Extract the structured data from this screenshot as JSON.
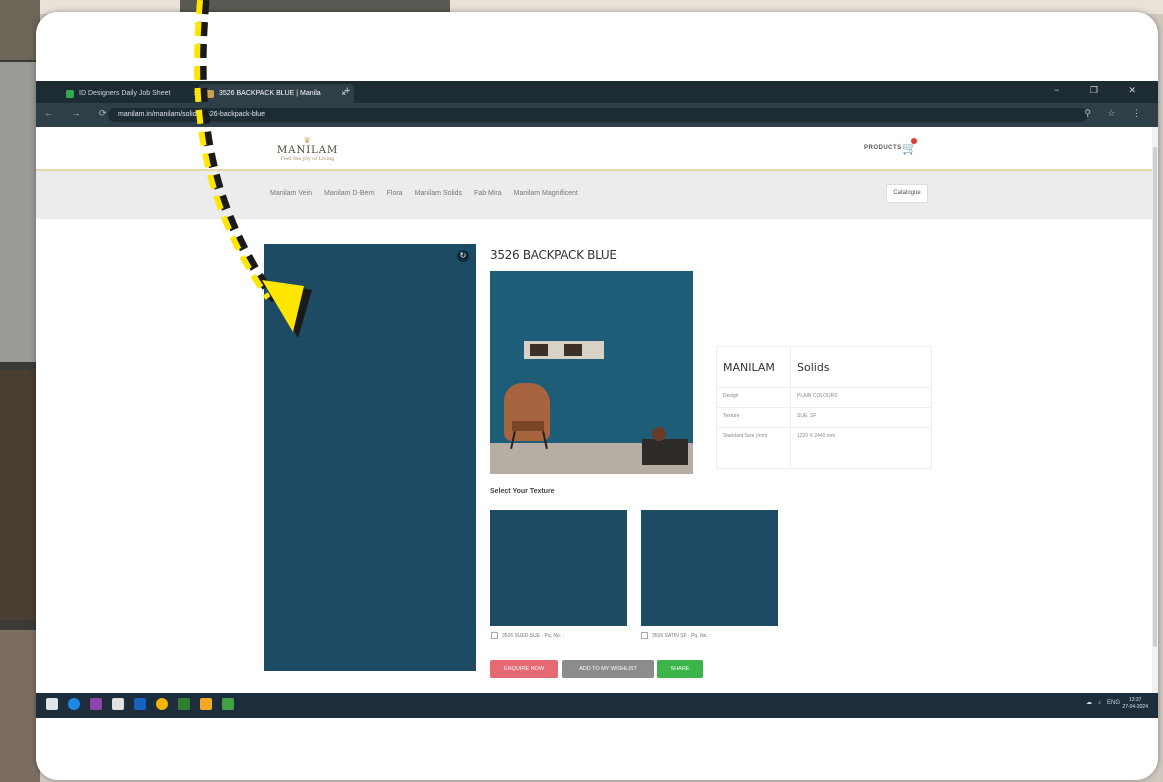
{
  "browser": {
    "tabs": [
      {
        "label": "ID Designers Daily Job Sheet",
        "icon_color": "#34a853"
      },
      {
        "label": "3526 BACKPACK BLUE | Manila",
        "icon_color": "#c9a24b"
      }
    ],
    "url": "manilam.in/manilam/solids/3526-backpack-blue",
    "new_tab_symbol": "+",
    "window_controls": "− ❐ ✕"
  },
  "site": {
    "logo_text": "MANILAM",
    "logo_tagline": "Feel the Joy of Living",
    "products_label": "PRODUCTS",
    "nav_links": [
      "Manilam Vein",
      "Manilam D-Bern",
      "Flora",
      "Manilam Solids",
      "Fab Mira",
      "Manilam Magnificent"
    ],
    "catalogue_label": "Catalogue"
  },
  "product": {
    "title": "3526 BACKPACK BLUE",
    "color": "#1d4b63",
    "brand": "MANILAM",
    "collection": "Solids",
    "specs": [
      {
        "label": "Design",
        "value": "PLAIN COLOURS"
      },
      {
        "label": "Texture",
        "value": "SUE, SF"
      },
      {
        "label": "Standard Size (mm)",
        "value": "1220 X 2440 mm"
      }
    ],
    "select_texture_label": "Select Your Texture",
    "textures": [
      {
        "label": "3526 SUED SUE - Pq. No. :"
      },
      {
        "label": "3526 SATIN SF - Pq. No. :"
      }
    ],
    "buttons": {
      "enquire": "ENQUIRE NOW",
      "wishlist": "ADD TO MY WISHLIST",
      "share": "SHARE"
    }
  },
  "taskbar": {
    "tray_text": "ENG",
    "time": "13:37",
    "date": "27-04-2024"
  }
}
